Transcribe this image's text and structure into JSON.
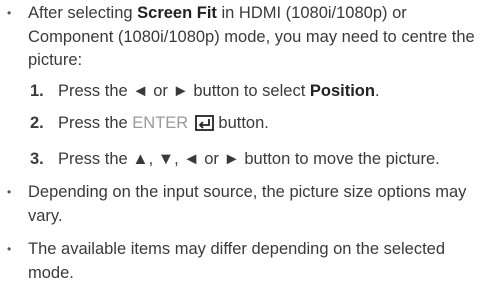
{
  "bullets": [
    {
      "parts": [
        "After selecting ",
        "Screen Fit",
        " in HDMI (1080i/1080p) or Component (1080i/1080p) mode, you may need to centre the picture:"
      ]
    },
    {
      "text": "Depending on the input source, the picture size options may vary."
    },
    {
      "text": "The available items may differ depending on the selected mode."
    }
  ],
  "bullet_glyph": "•",
  "steps": [
    {
      "num": "1.",
      "parts": [
        "Press the ◄ or ► button to select ",
        "Position",
        "."
      ]
    },
    {
      "num": "2.",
      "parts": [
        "Press the ",
        "ENTER",
        " button."
      ],
      "icon": "enter-return-icon"
    },
    {
      "num": "3.",
      "text": "Press the ▲, ▼, ◄ or ► button to move the picture."
    }
  ]
}
